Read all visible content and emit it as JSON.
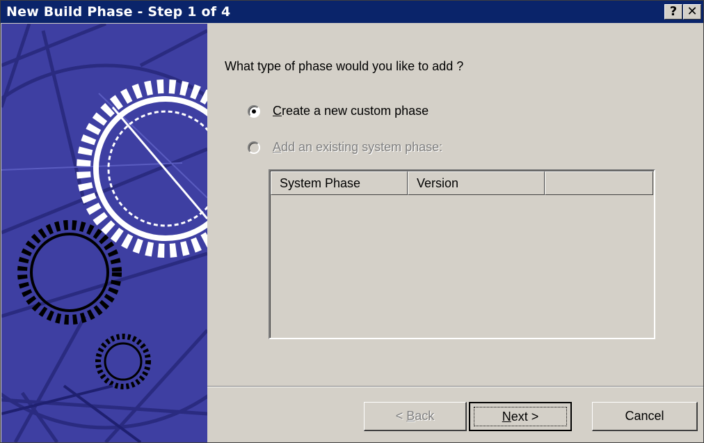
{
  "window": {
    "title": "New Build Phase - Step 1 of 4",
    "help_btn": "?",
    "close_btn": "✕"
  },
  "content": {
    "question": "What type of phase would you like to add ?",
    "options": [
      {
        "access_key": "C",
        "rest": "reate a new custom phase",
        "selected": true,
        "enabled": true
      },
      {
        "access_key": "A",
        "rest": "dd an existing system phase:",
        "selected": false,
        "enabled": false
      }
    ],
    "list": {
      "columns": [
        "System Phase",
        "Version",
        ""
      ],
      "rows": []
    }
  },
  "buttons": {
    "back": {
      "prefix": "< ",
      "key": "B",
      "rest": "ack"
    },
    "next": {
      "key": "N",
      "rest": "ext >"
    },
    "cancel": "Cancel"
  },
  "colors": {
    "title_bar": "#0a246a",
    "banner": "#3e3fa2",
    "dialog_face": "#d4d0c8"
  }
}
